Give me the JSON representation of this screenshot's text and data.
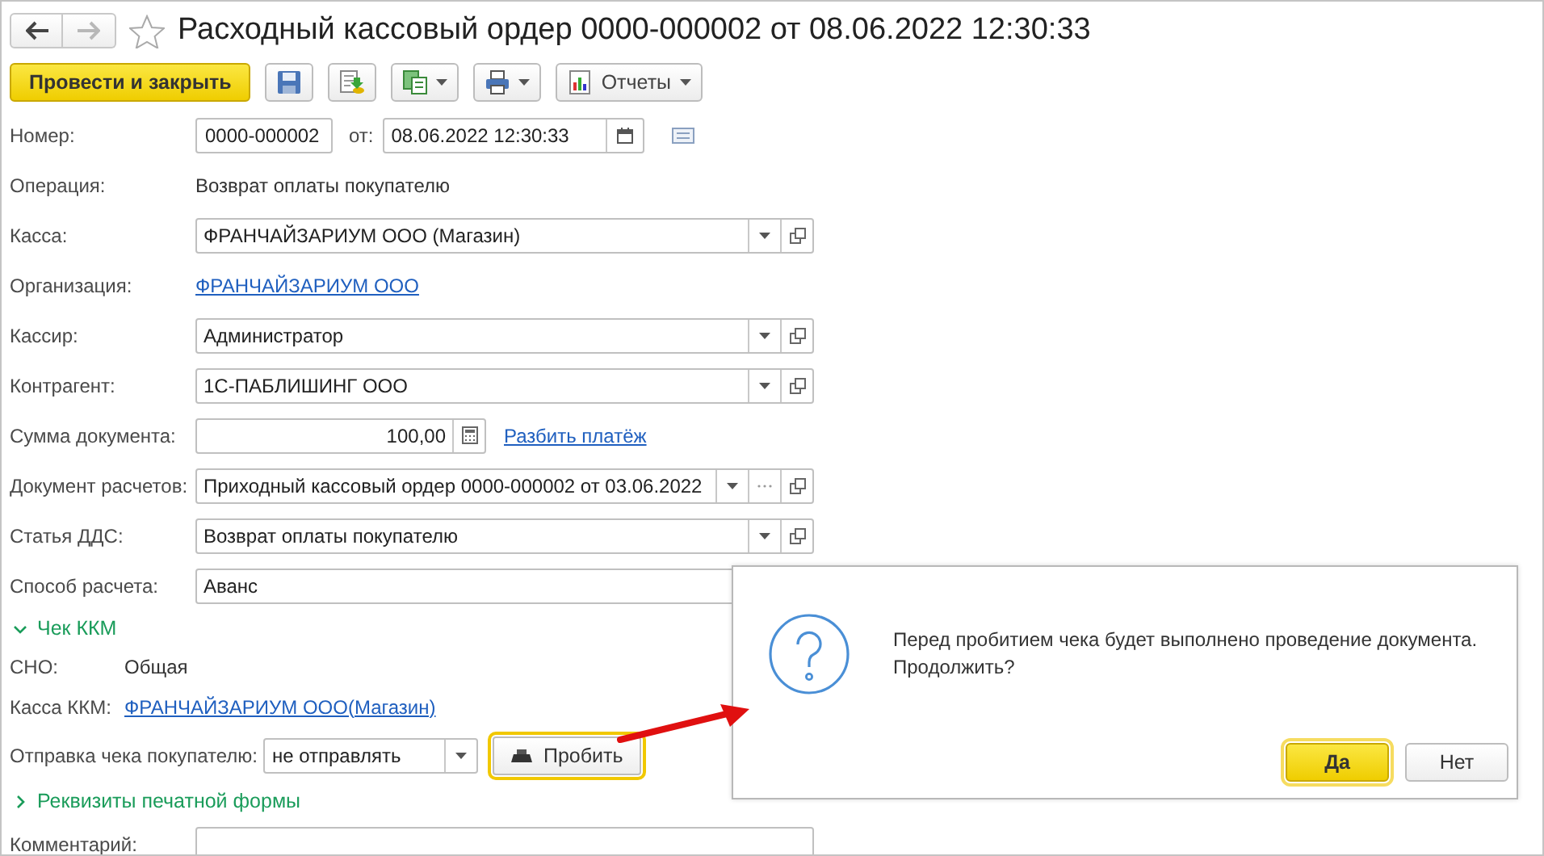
{
  "window": {
    "title": "Расходный кассовый ордер 0000-000002 от 08.06.2022 12:30:33",
    "favorite": false
  },
  "nav": [
    {
      "kind": "back",
      "disabled": false
    },
    {
      "kind": "forward",
      "disabled": true
    }
  ],
  "toolbar": {
    "primary": "Провести и закрыть",
    "buttons": [
      {
        "kind": "save",
        "dropdown": false
      },
      {
        "kind": "post",
        "dropdown": false
      },
      {
        "kind": "copy",
        "dropdown": true
      },
      {
        "kind": "print",
        "dropdown": true
      },
      {
        "kind": "reports",
        "label": "Отчеты",
        "dropdown": true
      }
    ]
  },
  "header": {
    "number_label": "Номер:",
    "number": "0000-000002",
    "date_label": "от:",
    "date": "08.06.2022 12:30:33"
  },
  "rows": [
    {
      "kind": "static",
      "label": "Операция:",
      "value": "Возврат оплаты покупателю"
    },
    {
      "kind": "select",
      "label": "Касса:",
      "value": "ФРАНЧАЙЗАРИУМ ООО (Магазин)",
      "dropdown": true,
      "open": true
    },
    {
      "kind": "link",
      "label": "Организация:",
      "value": "ФРАНЧАЙЗАРИУМ ООО"
    },
    {
      "kind": "select",
      "label": "Кассир:",
      "value": "Администратор",
      "dropdown": true,
      "open": true
    },
    {
      "kind": "select",
      "label": "Контрагент:",
      "value": "1С-ПАБЛИШИНГ ООО",
      "dropdown": true,
      "open": true
    },
    {
      "kind": "amount",
      "label": "Сумма документа:",
      "value": "100,00",
      "link": "Разбить платёж"
    },
    {
      "kind": "select",
      "label": "Документ расчетов:",
      "value": "Приходный кассовый ордер 0000-000002 от 03.06.2022",
      "dropdown": true,
      "choose": true,
      "open": true
    },
    {
      "kind": "select",
      "label": "Статья ДДС:",
      "value": "Возврат оплаты покупателю",
      "dropdown": true,
      "open": true
    },
    {
      "kind": "select",
      "label": "Способ расчета:",
      "value": "Аванс"
    },
    {
      "kind": "section",
      "label": "Чек ККМ",
      "expanded": true
    },
    {
      "kind": "compact-static",
      "label": "СНО:",
      "value": "Общая"
    },
    {
      "kind": "compact-link",
      "label": "Касса ККМ:",
      "value": "ФРАНЧАЙЗАРИУМ ООО(Магазин)"
    },
    {
      "kind": "compact-select",
      "label": "Отправка чека покупателю:",
      "value": "не отправлять",
      "dropdown": true,
      "button": {
        "label": "Пробить",
        "focused": true
      }
    },
    {
      "kind": "section",
      "label": "Реквизиты печатной формы",
      "expanded": false
    },
    {
      "kind": "input",
      "label": "Комментарий:"
    }
  ],
  "dialog": {
    "message": "Перед пробитием чека будет выполнено проведение документа.\nПродолжить?",
    "buttons": [
      {
        "label": "Да",
        "default": true
      },
      {
        "label": "Нет",
        "default": false
      }
    ]
  }
}
